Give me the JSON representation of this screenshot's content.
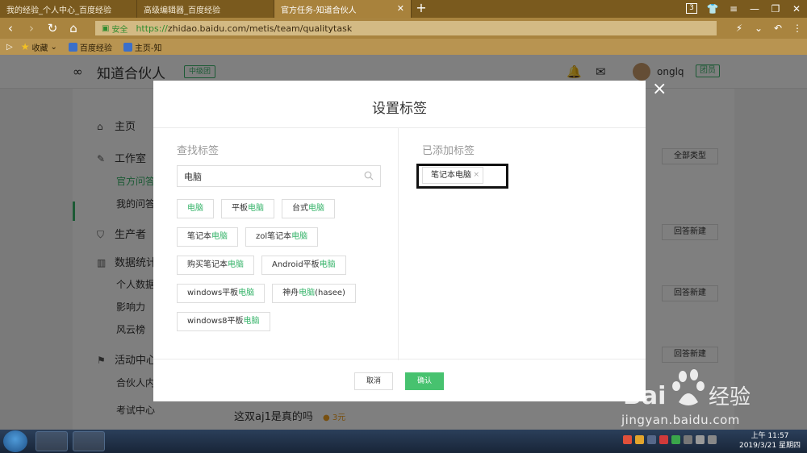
{
  "browser": {
    "tabs": [
      {
        "title": "我的经验_个人中心_百度经验"
      },
      {
        "title": "高级编辑器_百度经验"
      },
      {
        "title": "官方任务-知道合伙人",
        "active": true
      }
    ],
    "new_tab": "+",
    "tab_count": "3",
    "url_protocol": "https://",
    "url_rest": "zhidao.baidu.com/metis/team/qualitytask",
    "secure_label": "安全",
    "bookmarks": [
      {
        "label": "收藏",
        "icon": "star-icon"
      },
      {
        "label": "百度经验",
        "icon": "baidu-icon"
      },
      {
        "label": "主页-知",
        "icon": "page-icon"
      }
    ]
  },
  "site": {
    "logo_text": "知道合伙人",
    "level_badge": "中级团",
    "username": "onglq",
    "member_badge": "团员"
  },
  "sidebar": {
    "home": "主页",
    "workroom": "工作室",
    "official_qa": "官方问答",
    "my_qa": "我的问答",
    "producer": "生产者",
    "stats": "数据统计",
    "personal_data": "个人数据",
    "influence": "影响力",
    "ranking": "风云榜",
    "activity": "活动中心",
    "partner": "合伙人内",
    "exam": "考试中心"
  },
  "content": {
    "filter_label": "全部类型",
    "answer_button": "回答新建",
    "question_title": "这双aj1是真的吗",
    "question_reward": "3元"
  },
  "modal": {
    "title": "设置标签",
    "search_section_title": "查找标签",
    "added_section_title": "已添加标签",
    "search_value": "电脑",
    "keyword": "电脑",
    "suggestions": [
      {
        "pre": "",
        "hl": "电脑",
        "post": ""
      },
      {
        "pre": "平板",
        "hl": "电脑",
        "post": ""
      },
      {
        "pre": "台式",
        "hl": "电脑",
        "post": ""
      },
      {
        "pre": "笔记本",
        "hl": "电脑",
        "post": ""
      },
      {
        "pre": "zol笔记本",
        "hl": "电脑",
        "post": ""
      },
      {
        "pre": "购买笔记本",
        "hl": "电脑",
        "post": ""
      },
      {
        "pre": "Android平板",
        "hl": "电脑",
        "post": ""
      },
      {
        "pre": "windows平板",
        "hl": "电脑",
        "post": ""
      },
      {
        "pre": "神舟",
        "hl": "电脑",
        "post": "(hasee)"
      },
      {
        "pre": "windows8平板",
        "hl": "电脑",
        "post": ""
      }
    ],
    "added_tags": [
      "笔记本电脑"
    ],
    "remove_glyph": "×",
    "cancel_label": "取消",
    "confirm_label": "确认",
    "close_glyph": "×"
  },
  "watermark": {
    "brand_text": "Bai 经验",
    "url_text": "jingyan.baidu.com"
  },
  "taskbar": {
    "time": "上午 11:57",
    "date": "2019/3/21 星期四"
  },
  "colors": {
    "accent_green": "#38b46b",
    "confirm_green": "#47c26f",
    "chrome_brown": "#a9843f"
  }
}
